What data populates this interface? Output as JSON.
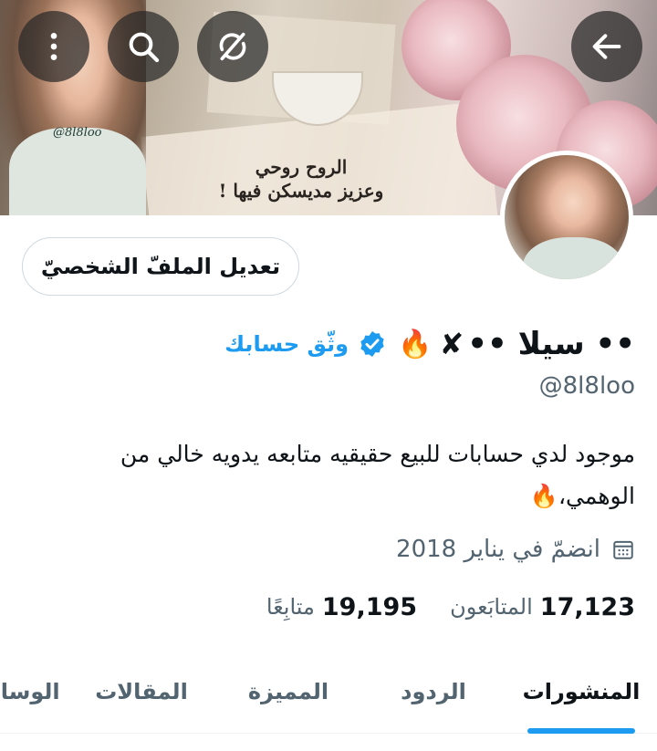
{
  "banner": {
    "calligraphy_line1": "الروح روحي",
    "calligraphy_line2": "وعزيز مديسكن فيها !",
    "watermark": "@8l8loo"
  },
  "profile": {
    "edit_button_label": "تعديل الملفّ الشخصيّ",
    "display_name": "•• سيلا ••",
    "get_verified_label": "وثّق حسابك",
    "handle": "@8l8loo",
    "bio_line1": "موجود لدي حسابات للبيع حقيقيه متابعه يدويه خالي من",
    "bio_line2": "الوهمي،🔥",
    "joined": "انضمّ في يناير 2018",
    "following_count": "17,123",
    "following_label": "المتابَعون",
    "followers_count": "19,195",
    "followers_label": "متابِعًا"
  },
  "tabs": [
    {
      "label": "المنشورات",
      "active": true
    },
    {
      "label": "الردود",
      "active": false
    },
    {
      "label": "المميزة",
      "active": false
    },
    {
      "label": "المقالات",
      "active": false
    },
    {
      "label": "الوسائط",
      "active": false
    }
  ],
  "icons": {
    "more": "more-vertical-icon",
    "search": "search-icon",
    "sync": "sync-off-icon",
    "back": "arrow-left-icon",
    "verified": "verified-badge-icon",
    "calendar": "calendar-icon",
    "fire": "fire-icon",
    "cross": "cross-mark-icon"
  },
  "colors": {
    "accent": "#1d9bf0",
    "text_primary": "#0f1419",
    "text_secondary": "#536471",
    "border": "#cfd9de"
  }
}
